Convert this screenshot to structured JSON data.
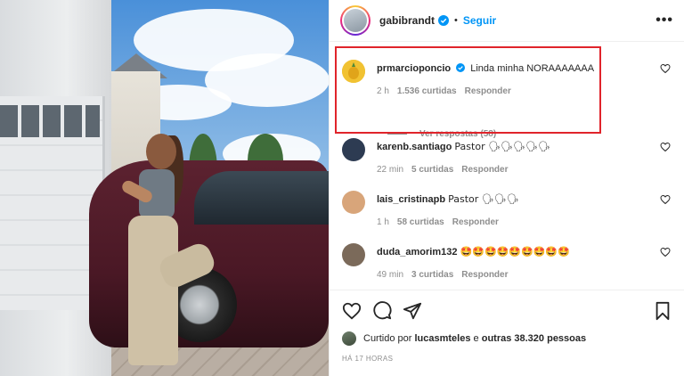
{
  "header": {
    "username": "gabibrandt",
    "dot": "•",
    "follow_label": "Seguir",
    "more_label": "•••"
  },
  "comments": [
    {
      "user": "prmarcioponcio",
      "text": "Linda minha NORAAAAAAA",
      "time": "2 h",
      "likes": "1.536 curtidas",
      "reply": "Responder",
      "view_replies": "Ver respostas (58)",
      "avatar_color": "#f1c232",
      "verified": true
    },
    {
      "user": "karenb.santiago",
      "text": "Pastor 🗣🗣🗣🗣🗣",
      "time": "22 min",
      "likes": "5 curtidas",
      "reply": "Responder",
      "avatar_color": "#2d3b52"
    },
    {
      "user": "lais_cristinapb",
      "text": "Pastor 🗣🗣🗣",
      "time": "1 h",
      "likes": "58 curtidas",
      "reply": "Responder",
      "avatar_color": "#d8a57a"
    },
    {
      "user": "duda_amorim132",
      "text": "🤩🤩🤩🤩🤩🤩🤩🤩🤩",
      "time": "49 min",
      "likes": "3 curtidas",
      "reply": "Responder",
      "avatar_color": "#7b6a5a"
    }
  ],
  "likes_line": {
    "prefix": "Curtido por",
    "user": "lucasmteles",
    "connector": "e",
    "others": "outras 38.320 pessoas"
  },
  "timestamp": "HÁ 17 HORAS",
  "colors": {
    "accent_blue": "#0095f6",
    "highlight_red": "#e0242b",
    "meta_gray": "#8e8e8e"
  },
  "icons": [
    "heart-icon",
    "comment-icon",
    "share-icon",
    "bookmark-icon",
    "verified-icon",
    "more-icon"
  ]
}
